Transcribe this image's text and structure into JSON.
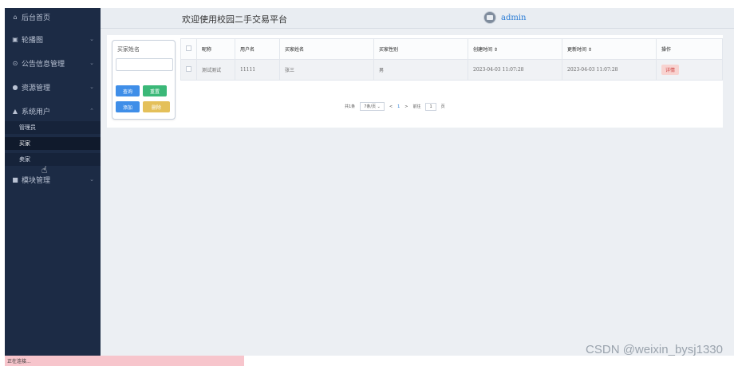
{
  "sidebar": {
    "items": [
      {
        "icon": "home-icon",
        "glyph": "⌂",
        "label": "后台首页"
      },
      {
        "icon": "image-icon",
        "glyph": "▣",
        "label": "轮播图"
      },
      {
        "icon": "clock-icon",
        "glyph": "⊙",
        "label": "公告信息管理"
      },
      {
        "icon": "resource-icon",
        "glyph": "●",
        "label": "资源管理"
      },
      {
        "icon": "user-icon",
        "glyph": "▲",
        "label": "系统用户"
      },
      {
        "icon": "grid-icon",
        "glyph": "■",
        "label": "模块管理"
      }
    ],
    "sub_items": [
      {
        "label": "管理员"
      },
      {
        "label": "买家"
      },
      {
        "label": "卖家"
      }
    ]
  },
  "header": {
    "welcome": "欢迎使用校园二手交易平台",
    "user": "admin"
  },
  "search": {
    "label": "买家姓名",
    "value": "",
    "buttons": {
      "query": "查询",
      "reset": "重置",
      "add": "添加",
      "delete": "删除"
    }
  },
  "table": {
    "headers": [
      "昵称",
      "用户名",
      "买家姓名",
      "买家性别",
      "创建时间 ⇕",
      "更新时间 ⇕",
      "操作"
    ],
    "rows": [
      {
        "nickname": "测试测试",
        "username": "11111",
        "name": "张三",
        "gender": "男",
        "created": "2023-04-03 11:07:28",
        "updated": "2023-04-03 11:07:28",
        "action": "详情"
      }
    ]
  },
  "pagination": {
    "total": "共1条",
    "per_page": "7条/页",
    "prev": "<",
    "page": "1",
    "next": ">",
    "goto": "前往",
    "goto_page": "1",
    "page_unit": "页"
  },
  "status_bar": "正在连接...",
  "watermark": "CSDN @weixin_bysj1330",
  "colors": {
    "sidebar_bg": "#1c2b45",
    "primary": "#3f8ee8",
    "success": "#3bb878",
    "warning": "#e4c05a",
    "danger_light": "#f8d3d0"
  }
}
